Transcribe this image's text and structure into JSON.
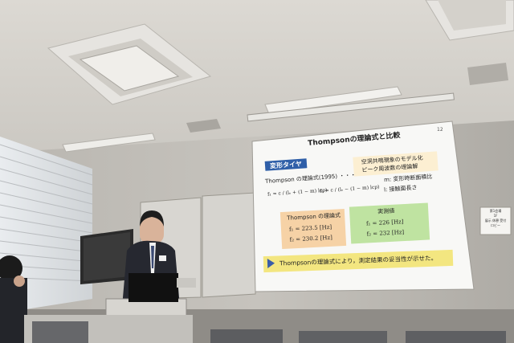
{
  "slide": {
    "title": "Thompsonの理論式と比較",
    "page_number": "12",
    "section_badge": "変形タイヤ",
    "model_label": "Thompson の理論式(1995) ・・・",
    "bullets": [
      "空洞共鳴現象のモデル化",
      "ピーク周波数の理論解"
    ],
    "variables": [
      "m: 変形時断面積比",
      "l: 接触面長さ"
    ],
    "formula_1": "f₁ = c / (lₑ + (1 − m) lcp)",
    "formula_2": "f₂ = c / (lₑ − (1 − m) lcp)",
    "theory": {
      "header": "Thompson の理論式",
      "f1": "f₁ = 223.5 [Hz]",
      "f2": "f₂ = 230.2 [Hz]"
    },
    "measured": {
      "header": "実測値",
      "f1": "f₁ = 226 [Hz]",
      "f2": "f₂ = 232 [Hz]"
    },
    "conclusion": "Thompsonの理論式により，測定結果の妥当性が示せた。"
  },
  "wall_sign": {
    "lines": [
      "第1会場",
      "1F",
      "展示 休憩 受付",
      "ロビー"
    ]
  },
  "colors": {
    "ceiling": "#d9d6d0",
    "wall": "#c8c5bf",
    "screen": "#ffffff",
    "badge": "#2f5fa8",
    "bullet_box": "#fcefd2",
    "theory_box": "#f6d2a6",
    "measured_box": "#bfe3a1",
    "conclusion_box": "#f3e680",
    "arrow": "#3a5da8"
  }
}
